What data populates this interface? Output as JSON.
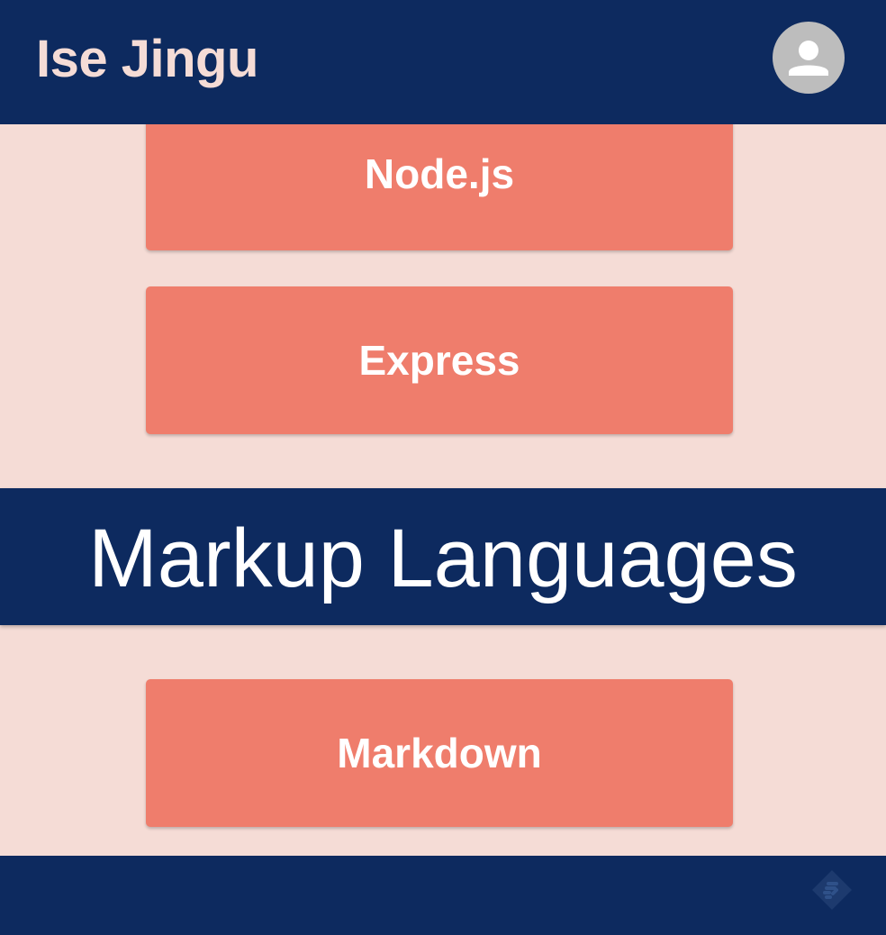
{
  "header": {
    "title": "Ise Jingu",
    "avatar_icon": "account-circle-icon"
  },
  "cards_top": [
    {
      "label": "Node.js"
    },
    {
      "label": "Express"
    }
  ],
  "section": {
    "heading": "Markup Languages",
    "cards": [
      {
        "label": "Markdown"
      }
    ]
  },
  "footer": {
    "icon": "feedly-icon"
  },
  "colors": {
    "navy": "#0d2a5f",
    "background": "#f5dcd6",
    "card": "#ef7d6c",
    "title_text": "#f5dcd6",
    "avatar_bg": "#bdbdbd"
  }
}
